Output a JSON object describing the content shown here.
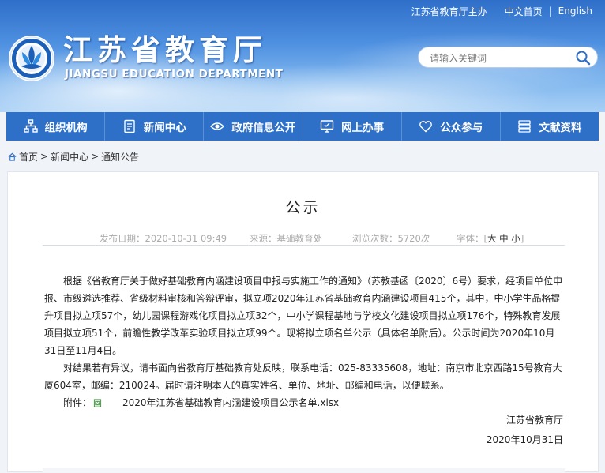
{
  "top_links": {
    "sponsor": "江苏省教育厅主办",
    "chinese_home": "中文首页",
    "separator": "|",
    "english": "English"
  },
  "header": {
    "title": "江苏省教育厅",
    "subtitle": "JIANGSU EDUCATION DEPARTMENT",
    "logo_icon": "provincial-education-emblem",
    "colors": {
      "sky_top": "#2f6fc9",
      "sky_bottom": "#a9d0f6"
    }
  },
  "search": {
    "placeholder": "请输入关键词",
    "icon": "search-icon"
  },
  "nav": {
    "background": "#2e70c8",
    "items": [
      {
        "label": "组织机构",
        "icon": "org-chart-icon"
      },
      {
        "label": "新闻中心",
        "icon": "document-icon"
      },
      {
        "label": "政府信息公开",
        "icon": "eye-icon"
      },
      {
        "label": "网上办事",
        "icon": "monitor-icon"
      },
      {
        "label": "公众参与",
        "icon": "heart-icon"
      },
      {
        "label": "文献资料",
        "icon": "books-icon"
      }
    ]
  },
  "breadcrumb": {
    "icon": "home-icon",
    "items": [
      "首页",
      "新闻中心",
      "通知公告"
    ],
    "separator": ">"
  },
  "article": {
    "title": "公示",
    "meta": {
      "publish_date": "发布日期：2020-10-31 09:49",
      "source": "来源：基础教育处",
      "views": "浏览次数：5720次",
      "font_size_label": "字体：",
      "font_large": "大",
      "font_medium": "中",
      "font_small": "小",
      "bracket_open": "[",
      "bracket_close": "]"
    },
    "paragraphs": [
      "根据《省教育厅关于做好基础教育内涵建设项目申报与实施工作的通知》（苏教基函〔2020〕6号）要求，经项目单位申报、市级遴选推荐、省级材料审核和答辩评审，拟立项2020年江苏省基础教育内涵建设项目415个，其中，中小学生品格提升项目拟立项57个，幼儿园课程游戏化项目拟立项32个，中小学课程基地与学校文化建设项目拟立项176个，特殊教育发展项目拟立项51个，前瞻性教学改革实验项目拟立项99个。现将拟立项名单公示（具体名单附后）。公示时间为2020年10月31日至11月4日。",
      "对结果若有异议，请书面向省教育厅基础教育处反映，联系电话：025-83335608，地址：南京市北京西路15号教育大厦604室，邮编：210024。届时请注明本人的真实姓名、单位、地址、邮编和电话，以便联系。"
    ],
    "attachment": {
      "label": "附件：",
      "icon": "excel-file-icon",
      "file_name": "2020年江苏省基础教育内涵建设项目公示名单.xlsx"
    },
    "signature": {
      "org": "江苏省教育厅",
      "date": "2020年10月31日"
    }
  }
}
